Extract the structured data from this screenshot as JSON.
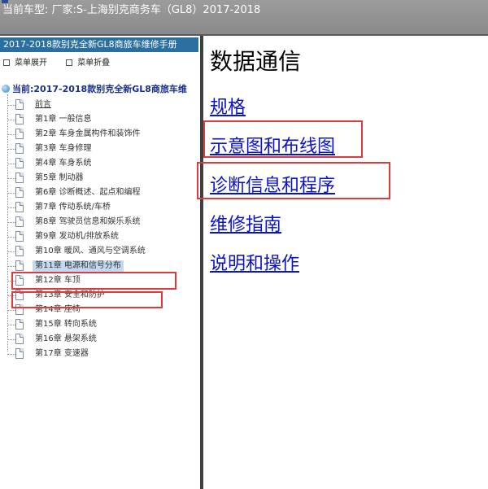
{
  "top_bar": {
    "title": "当前车型:  厂家:S-上海别克商务车（GL8）2017-2018"
  },
  "sidebar": {
    "manual_title": "2017-2018款别克全新GL8商旅车维修手册",
    "menu_expand": "菜单展开",
    "menu_collapse": "菜单折叠",
    "current_label": "当前:2017-2018款别克全新GL8商旅车维",
    "items": [
      {
        "label": "前言"
      },
      {
        "label": "第1章 一般信息"
      },
      {
        "label": "第2章 车身金属构件和装饰件"
      },
      {
        "label": "第3章 车身修理"
      },
      {
        "label": "第4章 车身系统"
      },
      {
        "label": "第5章 制动器"
      },
      {
        "label": "第6章 诊断概述、起点和编程"
      },
      {
        "label": "第7章 传动系统/车桥"
      },
      {
        "label": "第8章 驾驶员信息和娱乐系统"
      },
      {
        "label": "第9章 发动机/排放系统"
      },
      {
        "label": "第10章 暖风、通风与空调系统"
      },
      {
        "label": "第11章 电源和信号分布"
      },
      {
        "label": "第12章 车顶"
      },
      {
        "label": "第13章 安全和防护"
      },
      {
        "label": "第14章 座椅"
      },
      {
        "label": "第15章 转向系统"
      },
      {
        "label": "第16章 悬架系统"
      },
      {
        "label": "第17章 变速器"
      }
    ]
  },
  "content": {
    "heading": "数据通信",
    "links": [
      {
        "label": "规格"
      },
      {
        "label": "示意图和布线图"
      },
      {
        "label": "诊断信息和程序"
      },
      {
        "label": "维修指南"
      },
      {
        "label": "说明和操作"
      }
    ]
  },
  "colors": {
    "accent_red": "#e03a3a",
    "link_blue": "#0b13c8",
    "title_bar_blue": "#2a6fa0",
    "selected_bg": "#c4d8ee"
  }
}
